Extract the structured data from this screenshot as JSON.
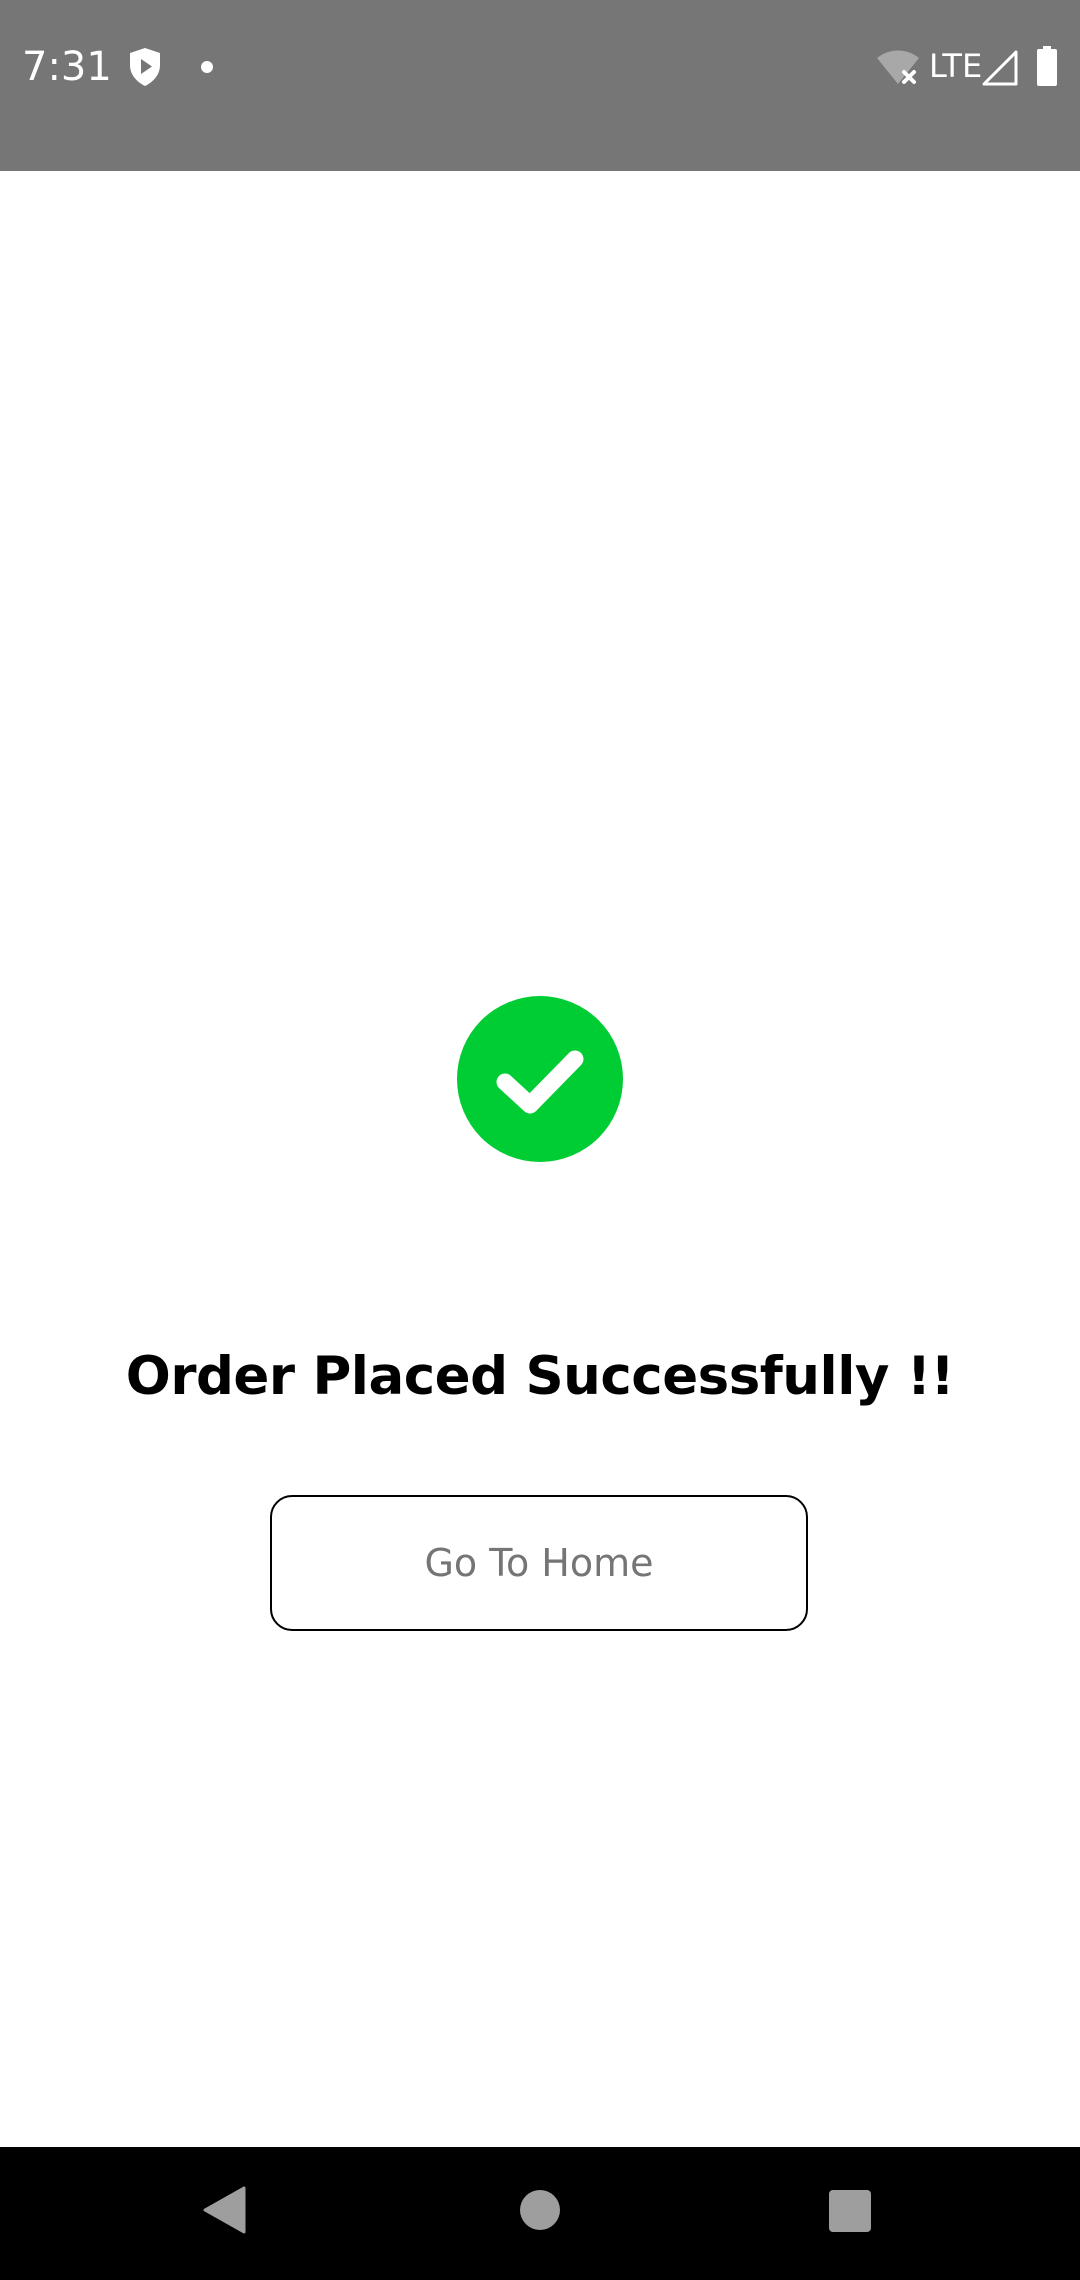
{
  "status_bar": {
    "time": "7:31",
    "network_label": "LTE",
    "background_color": "#767676",
    "icons": [
      "shield-play-icon",
      "notification-dot-icon",
      "wifi-off-icon",
      "cell-signal-icon",
      "battery-icon"
    ]
  },
  "main": {
    "success_icon": "check-circle-icon",
    "success_color": "#00cc33",
    "title": "Order Placed Successfully !!",
    "home_button_label": "Go To Home"
  },
  "nav_bar": {
    "buttons": [
      "back-icon",
      "home-icon",
      "recents-icon"
    ],
    "background_color": "#000000"
  }
}
